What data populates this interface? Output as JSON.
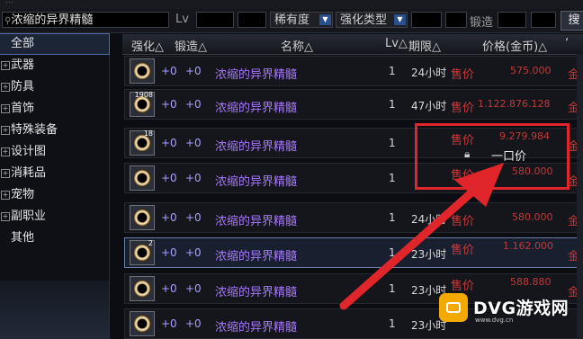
{
  "topbar": {
    "text": "..."
  },
  "search": {
    "query": "浓缩的异界精髓",
    "lv_label": "Lv",
    "rarity_label": "稀有度",
    "enhance_type_label": "强化类型",
    "forge_label": "锻造",
    "search_button": "搜"
  },
  "sidebar": {
    "items": [
      {
        "label": "全部",
        "expandable": false,
        "selected": true
      },
      {
        "label": "武器",
        "expandable": true
      },
      {
        "label": "防具",
        "expandable": true
      },
      {
        "label": "首饰",
        "expandable": true
      },
      {
        "label": "特殊装备",
        "expandable": true
      },
      {
        "label": "设计图",
        "expandable": true
      },
      {
        "label": "消耗品",
        "expandable": true
      },
      {
        "label": "宠物",
        "expandable": true
      },
      {
        "label": "副职业",
        "expandable": true
      },
      {
        "label": "其他",
        "expandable": false
      }
    ]
  },
  "columns": {
    "enhance": "强化△",
    "forge": "锻造△",
    "name": "名称△",
    "lv": "Lv△",
    "period": "期限△",
    "price": "价格(金币)△",
    "extra": "‘"
  },
  "rows": [
    {
      "count": "",
      "enhance": "+0",
      "forge": "+0",
      "name": "浓缩的异界精髓",
      "lv": "1",
      "period": "24小时",
      "sale_type": "售价",
      "price": "575.000",
      "currency": "金币"
    },
    {
      "count": "1908",
      "enhance": "+0",
      "forge": "+0",
      "name": "浓缩的异界精髓",
      "lv": "1",
      "period": "47小时",
      "sale_type": "售价",
      "price": "1.122.876.128",
      "currency": "金币"
    },
    {
      "count": "18",
      "enhance": "+0",
      "forge": "+0",
      "name": "浓缩的异界精髓",
      "lv": "1",
      "period": "",
      "sale_type": "售价",
      "price": "9.279.984",
      "currency": "金币"
    },
    {
      "count": "",
      "enhance": "+0",
      "forge": "+0",
      "name": "浓缩的异界精髓",
      "lv": "1",
      "period": "",
      "sale_type": "售价",
      "price": "580.000",
      "currency": "金币"
    },
    {
      "count": "",
      "enhance": "+0",
      "forge": "+0",
      "name": "浓缩的异界精髓",
      "lv": "1",
      "period": "24小时",
      "sale_type": "售价",
      "price": "580.000",
      "currency": "金币"
    },
    {
      "count": "2",
      "enhance": "+0",
      "forge": "+0",
      "name": "浓缩的异界精髓",
      "lv": "1",
      "period": "23小时",
      "sale_type": "售价",
      "price": "1.162.000",
      "currency": "金币"
    },
    {
      "count": "",
      "enhance": "+0",
      "forge": "+0",
      "name": "浓缩的异界精髓",
      "lv": "1",
      "period": "23小时",
      "sale_type": "售价",
      "price": "588.880",
      "currency": "金币"
    },
    {
      "count": "",
      "enhance": "+0",
      "forge": "+0",
      "name": "浓缩的异界精髓",
      "lv": "1",
      "period": "23小时",
      "sale_type": "售价",
      "price": "",
      "currency": ""
    }
  ],
  "popup": {
    "buyout_label": "一口价"
  },
  "watermark": {
    "brand": "DVG游戏网",
    "url": "www.dvg.cn"
  },
  "colors": {
    "price_red": "#c03a3a",
    "name_purple": "#a877ff",
    "annotation_red": "#e0262b",
    "selection_blue": "#4a6ea8"
  }
}
